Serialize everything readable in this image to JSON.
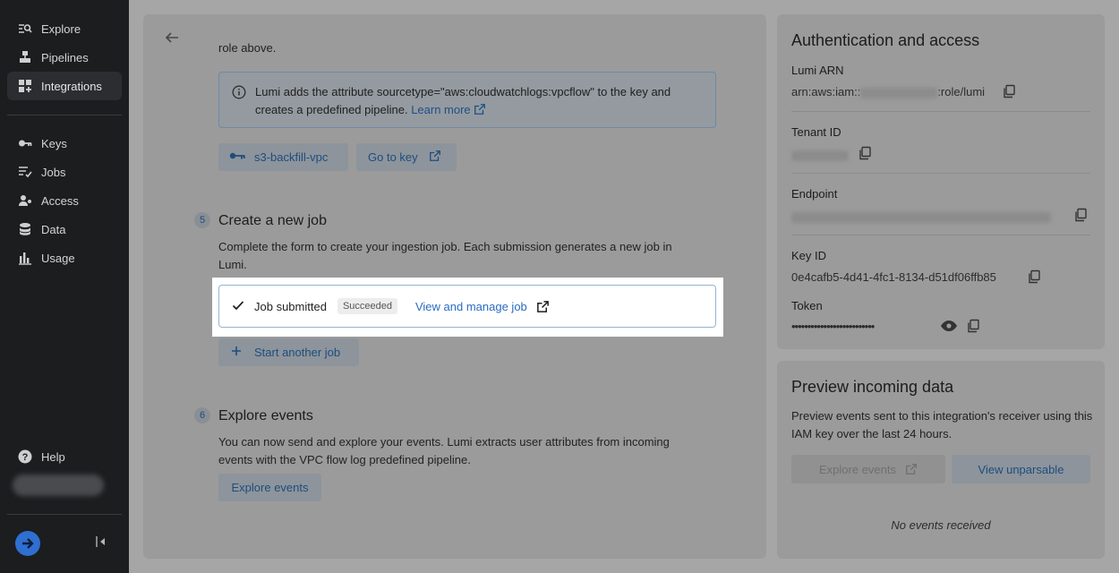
{
  "sidebar": {
    "items": [
      {
        "label": "Explore",
        "icon": "explore-icon"
      },
      {
        "label": "Pipelines",
        "icon": "pipelines-icon"
      },
      {
        "label": "Integrations",
        "icon": "integrations-icon"
      },
      {
        "label": "Keys",
        "icon": "key-icon"
      },
      {
        "label": "Jobs",
        "icon": "jobs-icon"
      },
      {
        "label": "Access",
        "icon": "access-icon"
      },
      {
        "label": "Data",
        "icon": "database-icon"
      },
      {
        "label": "Usage",
        "icon": "usage-icon"
      }
    ],
    "active": "Integrations",
    "help_label": "Help"
  },
  "main": {
    "role_text": "role above.",
    "info_text": "Lumi adds the attribute sourcetype=\"aws:cloudwatchlogs:vpcflow\" to the key and creates a predefined pipeline.",
    "info_link": "Learn more",
    "key_button": "s3-backfill-vpc",
    "go_to_key": "Go to key",
    "step5": {
      "number": "5",
      "title": "Create a new job",
      "desc": "Complete the form to create your ingestion job. Each submission generates a new job in Lumi.",
      "job_status": "Job submitted",
      "badge": "Succeeded",
      "manage_link": "View and manage job",
      "start_another": "Start another job"
    },
    "step6": {
      "number": "6",
      "title": "Explore events",
      "desc": "You can now send and explore your events. Lumi extracts user attributes from incoming events with the VPC flow log predefined pipeline.",
      "button": "Explore events"
    }
  },
  "auth": {
    "title": "Authentication and access",
    "lumi_arn_label": "Lumi ARN",
    "lumi_arn_prefix": "arn:aws:iam::",
    "lumi_arn_suffix": ":role/lumi",
    "tenant_label": "Tenant ID",
    "endpoint_label": "Endpoint",
    "key_id_label": "Key ID",
    "key_id_value": "0e4cafb5-4d41-4fc1-8134-d51df06ffb85",
    "token_label": "Token",
    "token_value": "••••••••••••••••••••••••••"
  },
  "preview": {
    "title": "Preview incoming data",
    "desc": "Preview events sent to this integration's receiver using this IAM key over the last 24 hours.",
    "explore_button": "Explore events",
    "unparsable_button": "View unparsable",
    "empty_text": "No events received"
  }
}
